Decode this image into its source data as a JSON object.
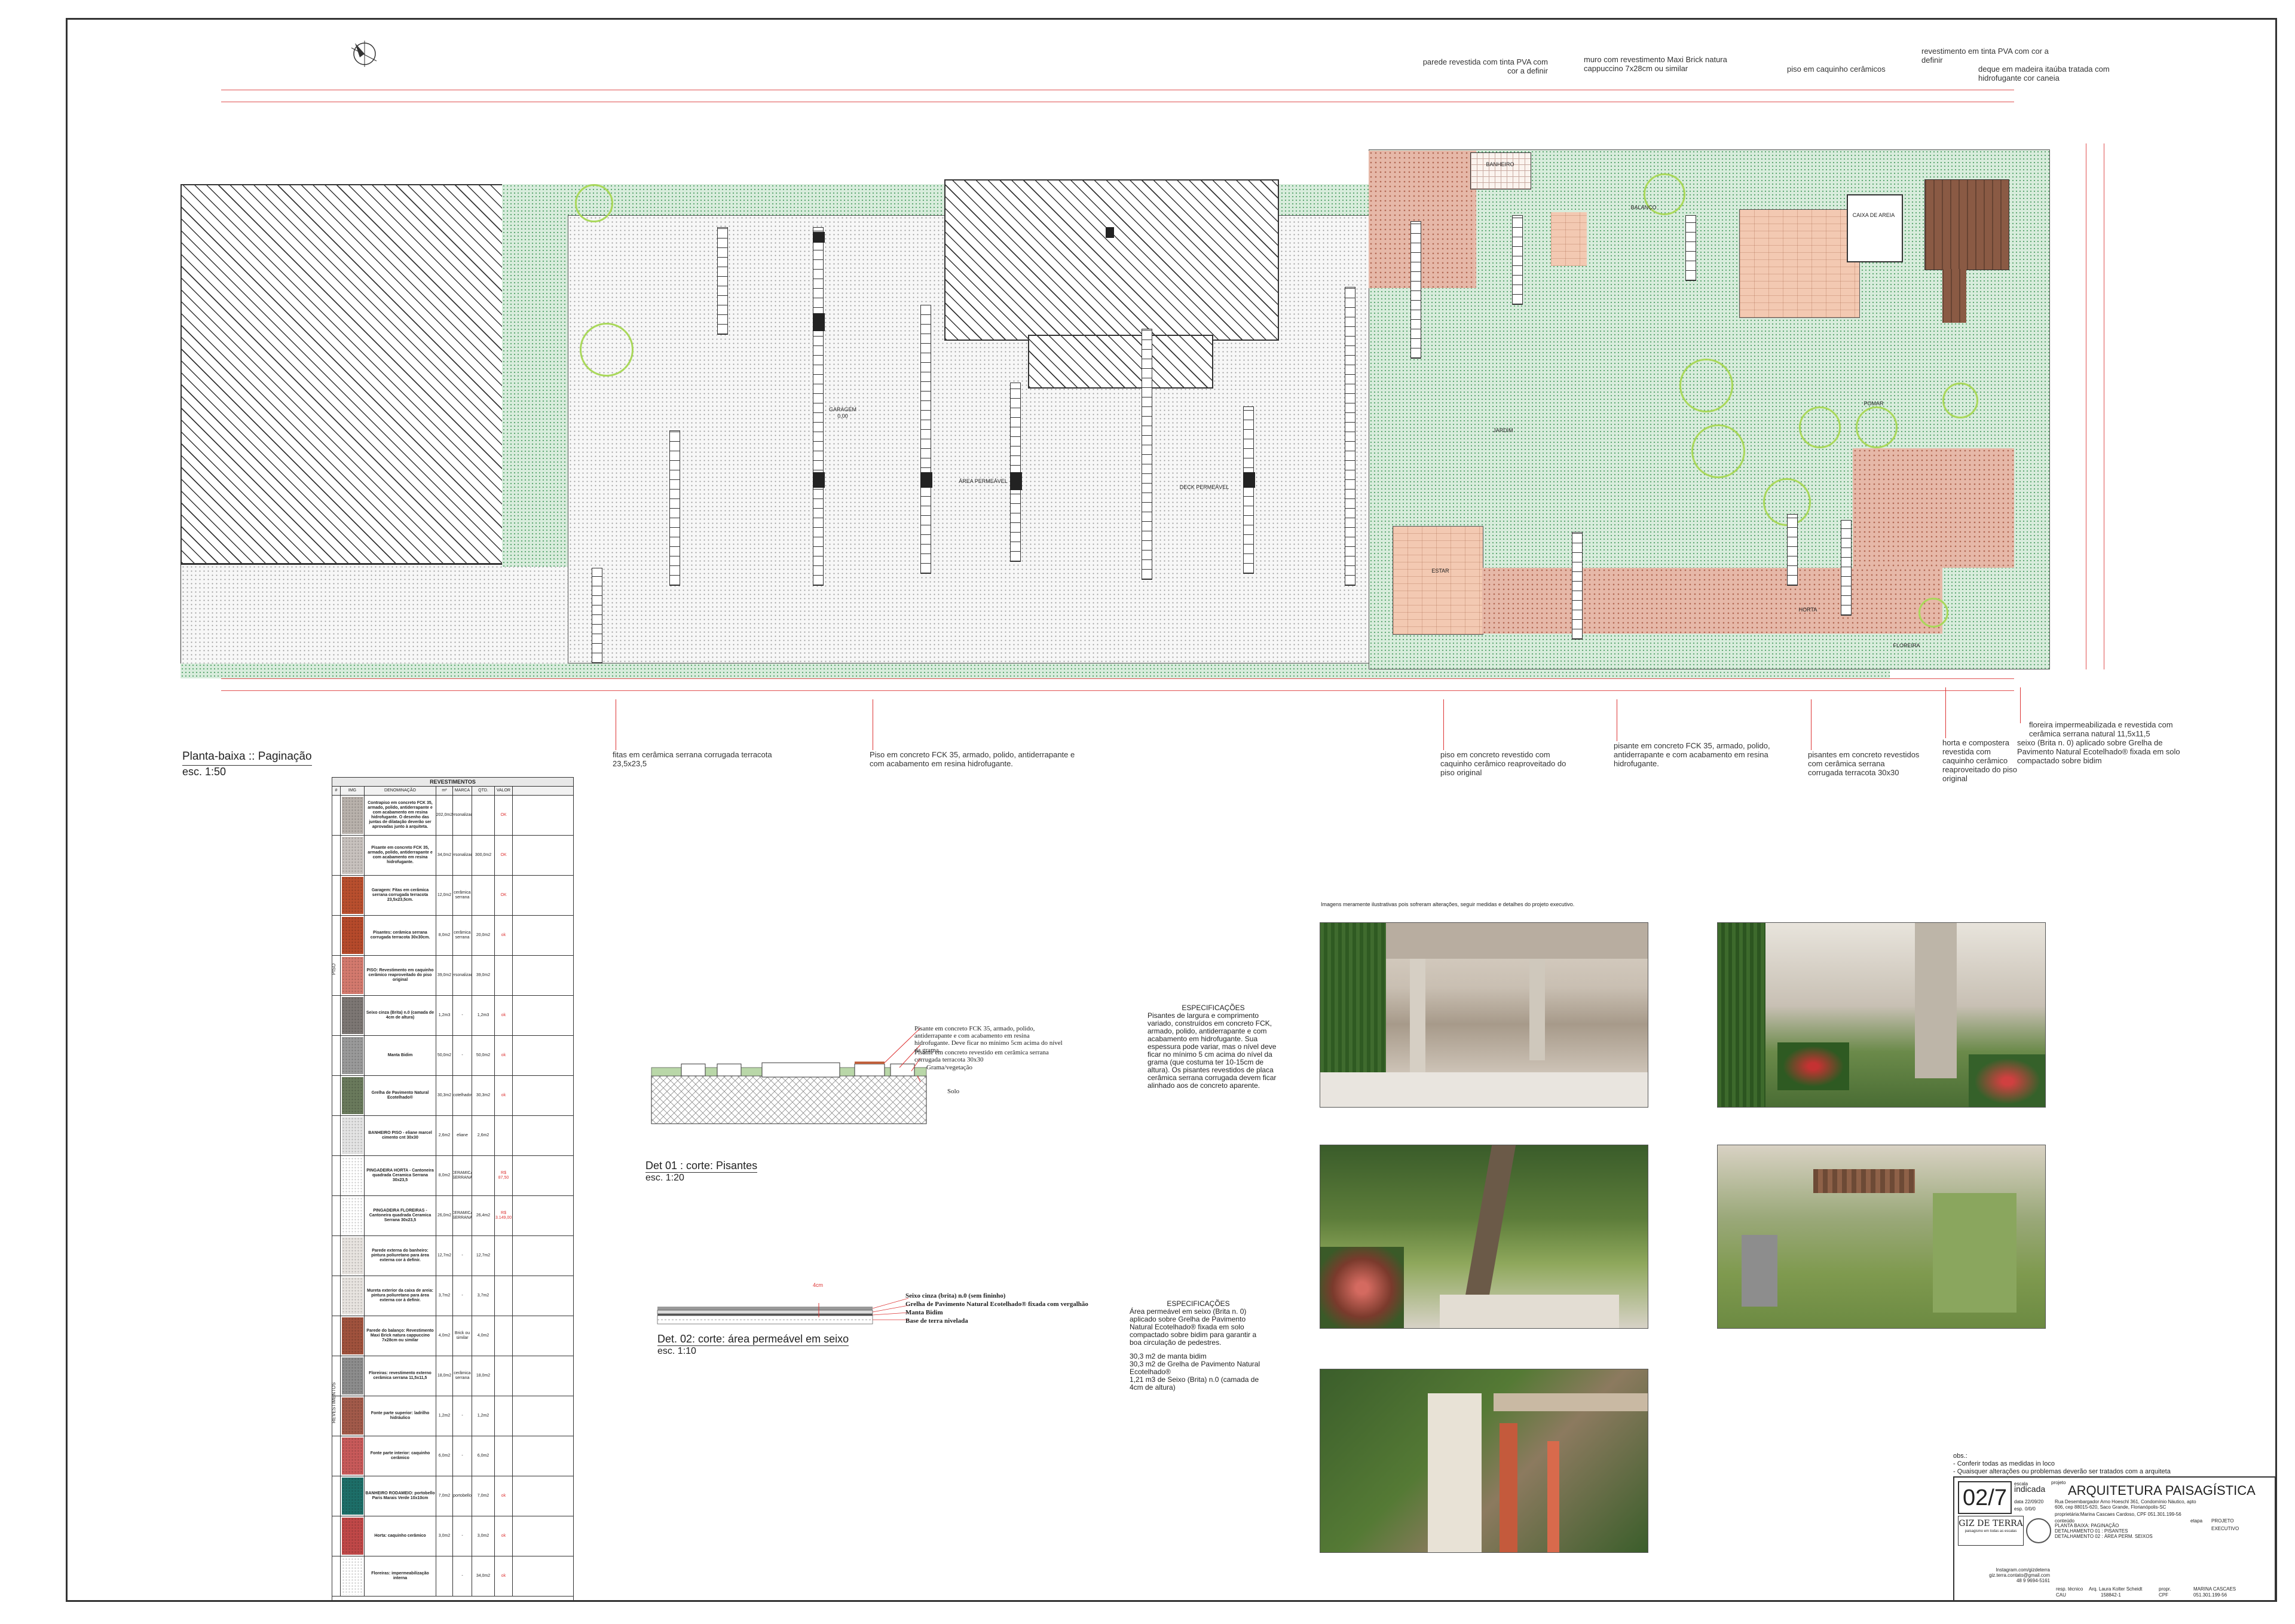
{
  "plan": {
    "title": "Planta-baixa :: Paginação",
    "scale": "esc. 1:50",
    "rooms": {
      "garagem": "GARAGEM",
      "area_permeavel": "ÁREA PERMEÁVEL",
      "deck_permeavel": "DECK PERMEÁVEL",
      "jardim": "JARDIM",
      "estar": "ESTAR",
      "banheiro": "BANHEIRO",
      "balanco": "BALANÇO",
      "caixa_areia": "CAIXA DE AREIA",
      "horta": "HORTA",
      "floreira": "FLOREIRA",
      "pomar": "POMAR"
    },
    "level": "0,00"
  },
  "callouts_top": [
    "parede revestida com tinta PVA com cor a definir",
    "muro com revestimento Maxi Brick natura cappuccino 7x28cm ou similar",
    "piso em caquinho cerâmicos",
    "revestimento em tinta PVA com cor a definir",
    "deque em madeira itaúba tratada com hidrofugante cor caneia"
  ],
  "callouts_bottom": [
    "fitas em cerâmica serrana corrugada terracota 23,5x23,5",
    "Piso em concreto FCK 35, armado, polido, antiderrapante e com acabamento em resina hidrofugante.",
    "piso em concreto revestido com caquinho cerâmico reaproveitado do piso original",
    "pisante em concreto FCK 35, armado, polido, antiderrapante e com acabamento em resina hidrofugante.",
    "pisantes em concreto revestidos com cerâmica serrana corrugada terracota 30x30",
    "horta e compostera revestida com caquinho cerâmico reaproveitado do piso original",
    "floreira impermeabilizada e revestida com cerâmica serrana natural 11,5x11,5",
    "seixo (Brita n. 0) aplicado sobre Grelha de Pavimento Natural Ecotelhado® fixada em solo compactado sobre bidim"
  ],
  "schedule": {
    "title": "REVESTIMENTOS",
    "headers": [
      "#",
      "IMG",
      "DENOMINAÇÃO",
      "m²",
      "MARCA",
      "QTD. TOTAL",
      "VALOR M2"
    ],
    "group_floor": "PISO",
    "group_wall": "REVESTIMENTOS",
    "rows": [
      {
        "name": "Contrapiso em concreto FCK 35, armado, polido, antiderrapante e com acabamento em resina hidrofugante. O desenho das juntas de dilatação deverão ser aprovadas junto à arquiteta.",
        "m2": "202,0m2",
        "brand": "personalizado",
        "total": "",
        "value": "OK"
      },
      {
        "name": "Pisante em concreto FCK 35, armado, polido, antiderrapante e com acabamento em resina hidrofugante.",
        "m2": "34,0m2",
        "brand": "personalizado",
        "total": "300,0m2",
        "value": "OK"
      },
      {
        "name": "Garagem: Fitas em cerâmica serrana corrugada terracota 23,5x23,5cm.",
        "m2": "12,0m2",
        "brand": "cerâmica serrana",
        "total": "",
        "value": "OK"
      },
      {
        "name": "Pisantes: cerâmica serrana corrugada terracota 30x30cm.",
        "m2": "8,0m2",
        "brand": "cerâmica serrana",
        "total": "20,0m2",
        "value": "ok"
      },
      {
        "name": "PISO: Revestimento em caquinho cerâmico reaproveitado do piso original",
        "m2": "39,0m2",
        "brand": "personalizado",
        "total": "39,0m2",
        "value": ""
      },
      {
        "name": "Seixo cinza (Brita) n.0 (camada de 4cm de altura)",
        "m2": "1,2m3",
        "brand": "-",
        "total": "1,2m3",
        "value": "ok"
      },
      {
        "name": "Manta Bidim",
        "m2": "50,0m2",
        "brand": "-",
        "total": "50,0m2",
        "value": "ok"
      },
      {
        "name": "Grelha de Pavimento Natural Ecotelhado®",
        "m2": "30,3m2",
        "brand": "Ecotelhado®",
        "total": "30,3m2",
        "value": "ok"
      },
      {
        "name": "BANHEIRO PISO - eliane marcel cimento cnt 30x30",
        "m2": "2,6m2",
        "brand": "eliane",
        "total": "2,6m2",
        "value": ""
      },
      {
        "name": "PINGADEIRA HORTA - Cantoneira quadrada Ceramica Serrana 30x23,5",
        "m2": "8,0m2",
        "brand": "CERAMICA SERRANA",
        "total": "",
        "value": "R$ 87,50"
      },
      {
        "name": "PINGADEIRA FLOREIRAS - Cantoneira quadrada Ceramica Serrana 30x23,5",
        "m2": "26,0m2",
        "brand": "CERAMICA SERRANA",
        "total": "26,4m2",
        "value": "R$ 3.149,00"
      },
      {
        "name": "Parede externa do banheiro: pintura poliuretano para área externa cor à definir.",
        "m2": "12,7m2",
        "brand": "-",
        "total": "12,7m2",
        "value": ""
      },
      {
        "name": "Mureta exterior da caixa de areia: pintura poliuretano para área externa cor à definir.",
        "m2": "3,7m2",
        "brand": "-",
        "total": "3,7m2",
        "value": ""
      },
      {
        "name": "Parede do balanço: Revestimento Maxi Brick natura cappuccino 7x28cm ou similar",
        "m2": "4,0m2",
        "brand": "Brick ou similar",
        "total": "4,0m2",
        "value": ""
      },
      {
        "name": "Floreiras: revestimento externo cerâmica serrana 11,5x11,5",
        "m2": "18,0m2",
        "brand": "cerâmica serrana",
        "total": "18,0m2",
        "value": ""
      },
      {
        "name": "Fonte parte superior: ladrilho hidráulico",
        "m2": "1,2m2",
        "brand": "-",
        "total": "1,2m2",
        "value": ""
      },
      {
        "name": "Fonte parte interior: caquinho cerâmico",
        "m2": "6,0m2",
        "brand": "-",
        "total": "6,0m2",
        "value": ""
      },
      {
        "name": "BANHEIRO RODAMEIO: portobello Paris Marais Verde 10x10cm",
        "m2": "7,0m2",
        "brand": "portobello",
        "total": "7,0m2",
        "value": "ok"
      },
      {
        "name": "Horta: caquinho cerâmico",
        "m2": "3,0m2",
        "brand": "-",
        "total": "3,0m2",
        "value": "ok"
      },
      {
        "name": "Floreiras: impermeabilização interna",
        "m2": "",
        "brand": "-",
        "total": "34,0m2",
        "value": "ok"
      }
    ],
    "swatch_colors": [
      "#b9b2ac",
      "#c8c2be",
      "#b94f2e",
      "#b64a2b",
      "#d47a6e",
      "#7d7774",
      "#9a9a9a",
      "#6a7a5c",
      "#e4e4e4",
      "#ffffff",
      "#ffffff",
      "#e8e4e0",
      "#e8e4e0",
      "#a0523d",
      "#8d8d8d",
      "#a25a4a",
      "#c85a5a",
      "#1d6e68",
      "#c04848",
      "#ffffff"
    ]
  },
  "det01": {
    "title": "Det 01 : corte: Pisantes",
    "scale": "esc. 1:20",
    "labels": [
      "Pisante em concreto FCK 35, armado, polido, antiderrapante e com acabamento em resina hidrofugante. Deve ficar no mínimo 5cm acima do nível da grama.",
      "Pisante em concreto revestido em cerâmica serrana corrugada terracota 30x30",
      "Grama/vegetação",
      "Solo"
    ],
    "spec_title": "ESPECIFICAÇÕES",
    "spec_text": "Pisantes de largura e comprimento variado, construídos em concreto FCK, armado, polido, antiderrapante e com acabamento em hidrofugante. Sua espessura pode variar, mas o nível deve ficar no mínimo 5 cm acima do nível da grama (que costuma ter 10-15cm de altura). Os pisantes revestidos de placa cerâmica serrana corrugada devem ficar alinhado aos de concreto aparente."
  },
  "det02": {
    "title": "Det. 02: corte: área permeável em seixo",
    "scale": "esc. 1:10",
    "labels": [
      "Seixo cinza (brita) n.0 (sem fininho)",
      "Grelha de Pavimento Natural Ecotelhado® fixada com vergalhão",
      "Manta Bidim",
      "Base de terra nivelada"
    ],
    "dim": "4cm",
    "spec_title": "ESPECIFICAÇÕES",
    "spec_text": "Área permeável em seixo (Brita n. 0) aplicado sobre Grelha de Pavimento Natural Ecotelhado® fixada em solo compactado sobre bidim para garantir a boa circulação de pedestres.",
    "spec_qty": "30,3 m2 de manta bidim\n30,3 m2 de Grelha de Pavimento Natural Ecotelhado®\n1,21 m3 de Seixo (Brita) n.0 (camada de 4cm de altura)"
  },
  "renders_note": "Imagens meramente ilustrativas pois sofreram alterações, seguir medidas e detalhes do projeto executivo.",
  "obs": {
    "title": "obs.:",
    "lines": [
      "- Conferir todas as medidas in loco",
      "- Quaisquer alterações ou problemas deverão ser tratados com a arquiteta"
    ]
  },
  "titleblock": {
    "sheet": "02/7",
    "escala_label": "escala",
    "escala": "indicada",
    "data_label": "data",
    "data": "22/09/20",
    "esp_label": "esp.",
    "esp": "0/0/0",
    "projeto_label": "projeto",
    "project": "ARQUITETURA PAISAGÍSTICA",
    "address": "Rua Desembargador Arno Hoeschl 361, Condomínio Náutico, apto 606, cep 88015-620, Saco Grande, Florianópolis-SC",
    "owner": "proprietária:Marina Cascaes Cardoso, CPF 051.301.199-56",
    "conteudo_label": "conteúdo",
    "content": "PLANTA BAIXA: PAGINAÇÃO\nDETALHAMENTO 01 : PISANTES\nDETALHAMENTO 02 : ÁREA PERM. SEIXOS",
    "etapa_label": "etapa",
    "etapa": "PROJETO EXECUTIVO",
    "brand": "GIZ DE TERRA",
    "brand_sub": "paisagismo em todas as escalas",
    "contact": "Instagram.com/gizdeterra\ngiz.terra.contato@gmail.com\n48 9 9694-5161",
    "resp_label": "resp. técnico",
    "resp": "Arq. Laura Kolter Scheidt",
    "cau_label": "CAU",
    "cau": "158842-1",
    "prop_label": "propr.",
    "cpf_label": "CPF",
    "client": "MARINA CASCAES",
    "client_cpf": "051.301.199-56"
  }
}
